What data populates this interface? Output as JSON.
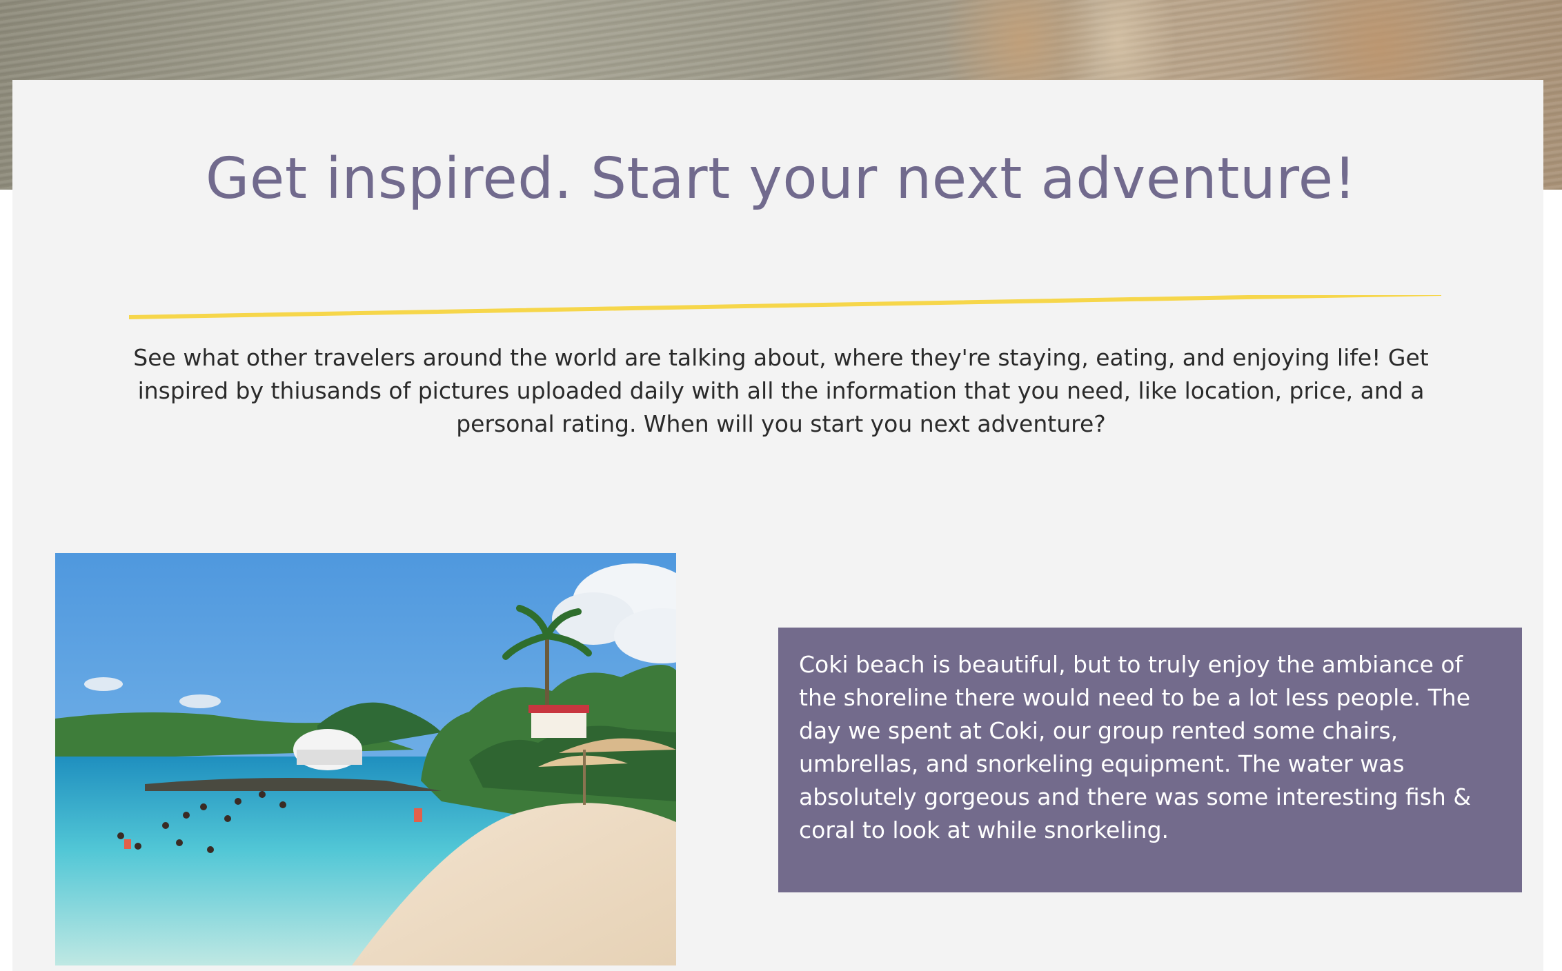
{
  "heading": {
    "title": "Get inspired. Start your next adventure!",
    "underline_color": "#f6d64a",
    "title_color": "#716a8d"
  },
  "intro": {
    "text": "See what other travelers around the world are talking about, where they're staying, eating, and enjoying life! Get inspired by thiusands of pictures uploaded daily with all the information that you need, like location, price, and a personal rating. When will you start you next adventure?"
  },
  "feature": {
    "image_icon": "beach-photo",
    "review": "Coki beach is beautiful, but to truly enjoy the ambiance of the shoreline there would need to be a lot less people. The day we spent at Coki, our group rented some chairs, umbrellas, and snorkeling equipment. The water was absolutely gorgeous and there was some interesting fish & coral to look at while snorkeling.",
    "card_color": "#736b8c"
  }
}
